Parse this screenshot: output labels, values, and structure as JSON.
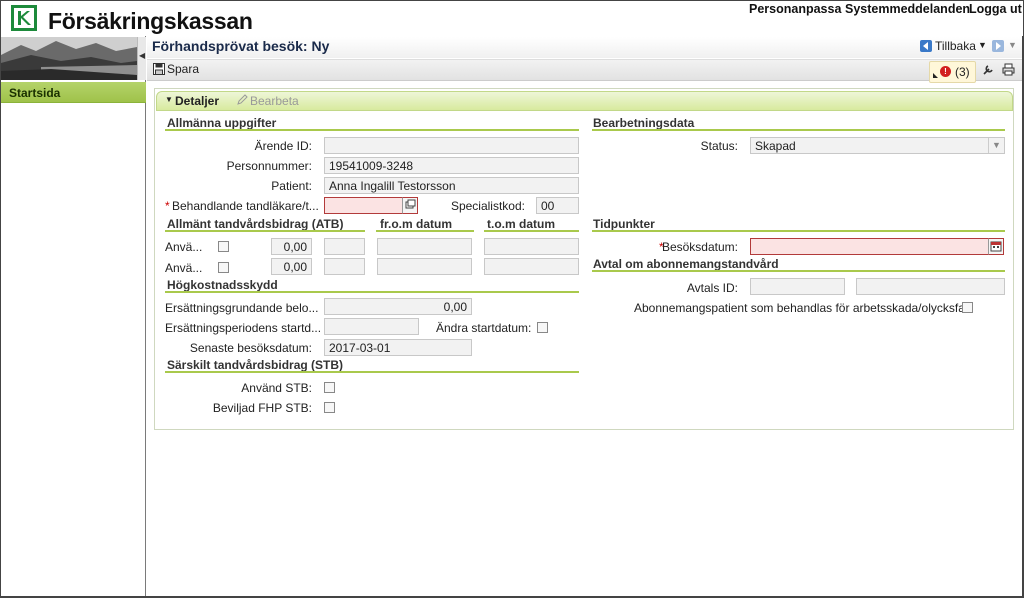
{
  "header": {
    "brand": "Försäkringskassan",
    "links": [
      "Personanpassa",
      "Systemmeddelanden",
      "Logga ut"
    ]
  },
  "sidebar": {
    "item": "Startsida"
  },
  "page": {
    "title": "Förhandsprövat besök: Ny",
    "back_label": "Tillbaka",
    "save_label": "Spara",
    "error_count": "(3)"
  },
  "panel": {
    "tab_details": "Detaljer",
    "tab_edit": "Bearbeta"
  },
  "allmanna": {
    "title": "Allmänna uppgifter",
    "arende_label": "Ärende ID:",
    "arende_value": "",
    "personnummer_label": "Personnummer:",
    "personnummer_value": "19541009-3248",
    "patient_label": "Patient:",
    "patient_value": "Anna Ingalill Testorsson",
    "behandlande_label": "Behandlande tandläkare/t...",
    "behandlande_value": "",
    "specialistkod_label": "Specialistkod:",
    "specialistkod_value": "00"
  },
  "atb": {
    "title": "Allmänt tandvårdsbidrag (ATB)",
    "col_from": "fr.o.m datum",
    "col_tom": "t.o.m datum",
    "rows": [
      {
        "label": "Anvä...",
        "amount": "0,00"
      },
      {
        "label": "Anvä...",
        "amount": "0,00"
      }
    ]
  },
  "hogkostnad": {
    "title": "Högkostnadsskydd",
    "ersattningsgrundande_label": "Ersättningsgrundande belo...",
    "ersattningsgrundande_value": "0,00",
    "startdatum_label": "Ersättningsperiodens startd...",
    "startdatum_value": "",
    "andra_label": "Ändra startdatum:",
    "senaste_label": "Senaste besöksdatum:",
    "senaste_value": "2017-03-01"
  },
  "stb": {
    "title": "Särskilt tandvårdsbidrag (STB)",
    "anvand_label": "Använd STB:",
    "fhp_label": "Beviljad FHP STB:"
  },
  "bearbetning": {
    "title": "Bearbetningsdata",
    "status_label": "Status:",
    "status_value": "Skapad"
  },
  "tidpunkter": {
    "title": "Tidpunkter",
    "besoksdatum_label": "Besöksdatum:",
    "besoksdatum_value": ""
  },
  "avtal": {
    "title": "Avtal om abonnemangstandvård",
    "avtals_label": "Avtals ID:",
    "abonnemang_label": "Abonnemangspatient som behandlas för arbetsskada/olycksfall:"
  },
  "colors": {
    "accent_green": "#a9c94c",
    "brand_green": "#1d8a3b",
    "required_red": "#b23a3a"
  }
}
